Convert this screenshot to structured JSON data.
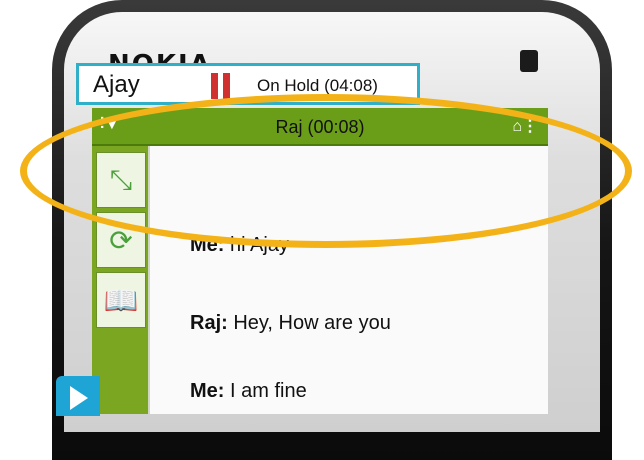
{
  "device": {
    "brand": "NOKIA"
  },
  "statusbar": {
    "signal_icon": "signal-icon",
    "battery_icon": "battery-icon",
    "active_call": "Raj (00:08)"
  },
  "held_call": {
    "name": "Ajay",
    "status": "On Hold (04:08)",
    "icon": "pause-icon"
  },
  "toolbar": {
    "items": [
      "merge-calls-icon",
      "swap-calls-icon",
      "contacts-book-icon"
    ]
  },
  "messages": [
    {
      "sender": "Me:",
      "text": " hi Ajay"
    },
    {
      "sender": "Raj:",
      "text": " Hey, How are you"
    },
    {
      "sender": "Me:",
      "text": "  I am fine"
    }
  ],
  "colors": {
    "highlight": "#f3b318",
    "accent_green": "#6b9e18",
    "hold_border": "#2fb0c8",
    "pause": "#d03030"
  }
}
